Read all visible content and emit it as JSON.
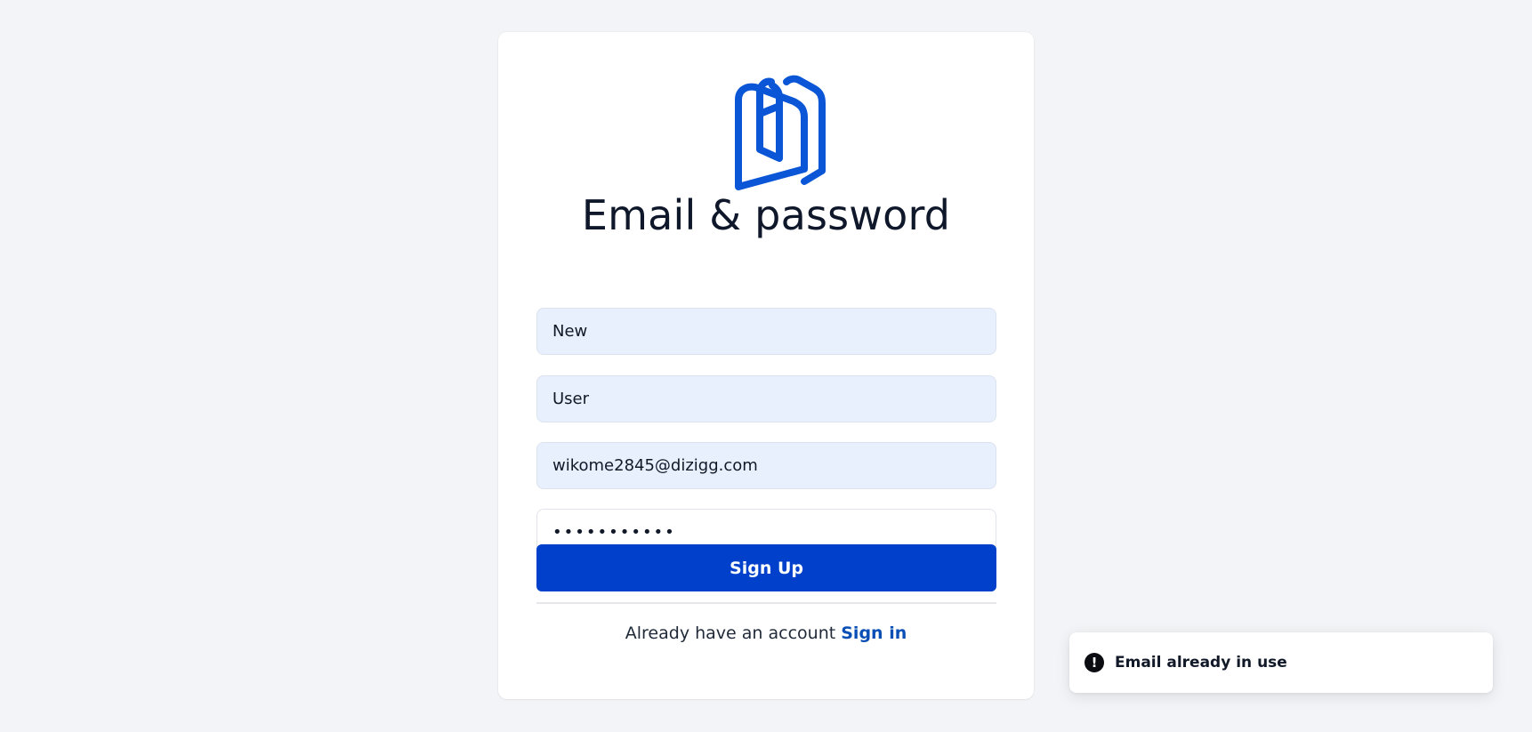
{
  "signup": {
    "heading": "Email & password",
    "first_name_value": "New",
    "last_name_value": "User",
    "email_value": "wikome2845@dizigg.com",
    "password_masked": "•••••••••••",
    "submit_label": "Sign Up",
    "footer_text": "Already have an account",
    "signin_link_label": "Sign in"
  },
  "toast": {
    "message": "Email already in use",
    "icon": "exclamation-circle-icon"
  },
  "colors": {
    "page_background": "#f2f4f7",
    "primary_button": "#0040ca",
    "link": "#0a4fb5",
    "logo": "#0a56d6",
    "autofill_input": "#e8f0fe"
  }
}
